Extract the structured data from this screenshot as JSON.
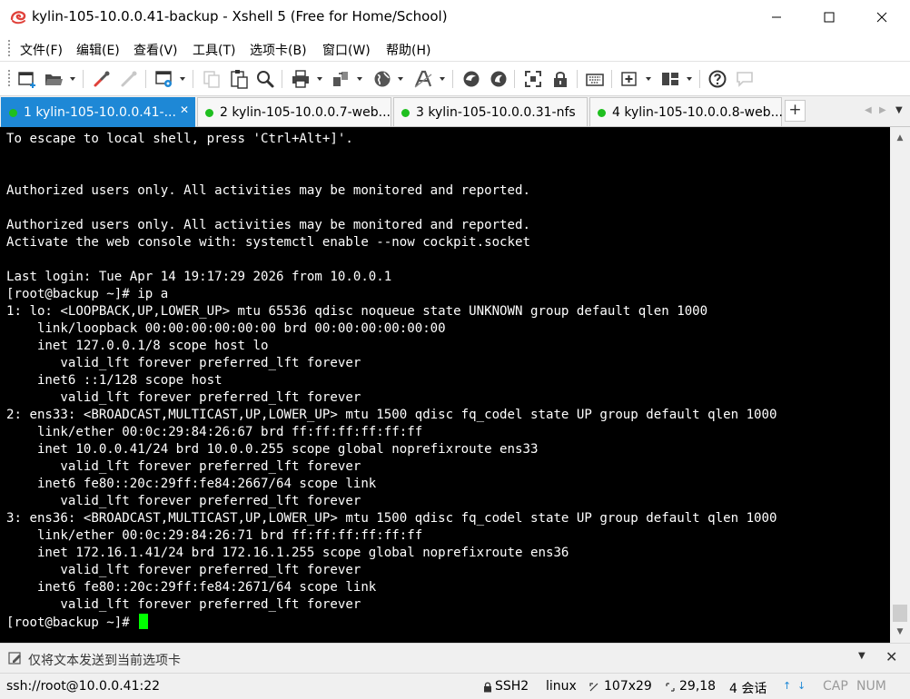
{
  "window": {
    "title": "kylin-105-10.0.0.41-backup - Xshell 5 (Free for Home/School)"
  },
  "menu": [
    "文件(F)",
    "编辑(E)",
    "查看(V)",
    "工具(T)",
    "选项卡(B)",
    "窗口(W)",
    "帮助(H)"
  ],
  "tabs": [
    {
      "label": "1 kylin-105-10.0.0.41-...",
      "active": true
    },
    {
      "label": "2 kylin-105-10.0.0.7-web...",
      "active": false
    },
    {
      "label": "3 kylin-105-10.0.0.31-nfs",
      "active": false
    },
    {
      "label": "4 kylin-105-10.0.0.8-web...",
      "active": false
    }
  ],
  "terminal": {
    "lines": [
      "To escape to local shell, press 'Ctrl+Alt+]'.",
      "",
      "",
      "Authorized users only. All activities may be monitored and reported.",
      "",
      "Authorized users only. All activities may be monitored and reported.",
      "Activate the web console with: systemctl enable --now cockpit.socket",
      "",
      "Last login: Tue Apr 14 19:17:29 2026 from 10.0.0.1",
      "[root@backup ~]# ip a",
      "1: lo: <LOOPBACK,UP,LOWER_UP> mtu 65536 qdisc noqueue state UNKNOWN group default qlen 1000",
      "    link/loopback 00:00:00:00:00:00 brd 00:00:00:00:00:00",
      "    inet 127.0.0.1/8 scope host lo",
      "       valid_lft forever preferred_lft forever",
      "    inet6 ::1/128 scope host",
      "       valid_lft forever preferred_lft forever",
      "2: ens33: <BROADCAST,MULTICAST,UP,LOWER_UP> mtu 1500 qdisc fq_codel state UP group default qlen 1000",
      "    link/ether 00:0c:29:84:26:67 brd ff:ff:ff:ff:ff:ff",
      "    inet 10.0.0.41/24 brd 10.0.0.255 scope global noprefixroute ens33",
      "       valid_lft forever preferred_lft forever",
      "    inet6 fe80::20c:29ff:fe84:2667/64 scope link",
      "       valid_lft forever preferred_lft forever",
      "3: ens36: <BROADCAST,MULTICAST,UP,LOWER_UP> mtu 1500 qdisc fq_codel state UP group default qlen 1000",
      "    link/ether 00:0c:29:84:26:71 brd ff:ff:ff:ff:ff:ff",
      "    inet 172.16.1.41/24 brd 172.16.1.255 scope global noprefixroute ens36",
      "       valid_lft forever preferred_lft forever",
      "    inet6 fe80::20c:29ff:fe84:2671/64 scope link",
      "       valid_lft forever preferred_lft forever"
    ],
    "prompt": "[root@backup ~]# ",
    "cursor_color": "#00ff00",
    "background": "#000000",
    "foreground": "#ffffff"
  },
  "compose": {
    "placeholder": "仅将文本发送到当前选项卡"
  },
  "status": {
    "connection": "ssh://root@10.0.0.41:22",
    "protocol": "SSH2",
    "terminal_type": "linux",
    "size": "107x29",
    "position": "29,18",
    "sessions": "4 会话",
    "cap": "CAP",
    "num": "NUM"
  },
  "colors": {
    "active_tab": "#1e88d6",
    "tab_status_dot": "#1fbf1f"
  }
}
